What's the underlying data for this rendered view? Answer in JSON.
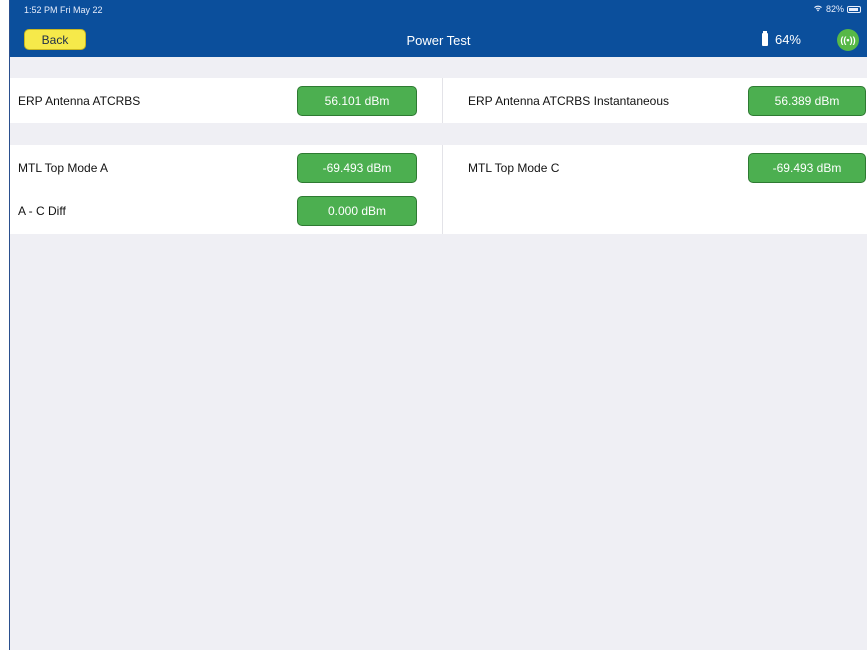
{
  "status_bar": {
    "time": "1:52 PM  Fri May 22",
    "wifi_icon": "wifi-icon",
    "battery_percent": "82%"
  },
  "nav": {
    "back_label": "Back",
    "title": "Power Test",
    "device_battery": "64%",
    "signal_icon_glyph": "((•))"
  },
  "section_erp": {
    "left": {
      "label": "ERP Antenna ATCRBS",
      "value": "56.101 dBm"
    },
    "right": {
      "label": "ERP Antenna ATCRBS Instantaneous",
      "value": "56.389 dBm"
    }
  },
  "section_mtl": {
    "mode_a": {
      "label": "MTL Top Mode A",
      "value": "-69.493 dBm"
    },
    "mode_c": {
      "label": "MTL Top Mode C",
      "value": "-69.493 dBm"
    },
    "diff": {
      "label": "A - C Diff",
      "value": "0.000 dBm"
    }
  },
  "colors": {
    "nav_bar": "#0b4f9c",
    "back_button": "#f6e94a",
    "value_green": "#4caf50",
    "background": "#efeff4"
  }
}
